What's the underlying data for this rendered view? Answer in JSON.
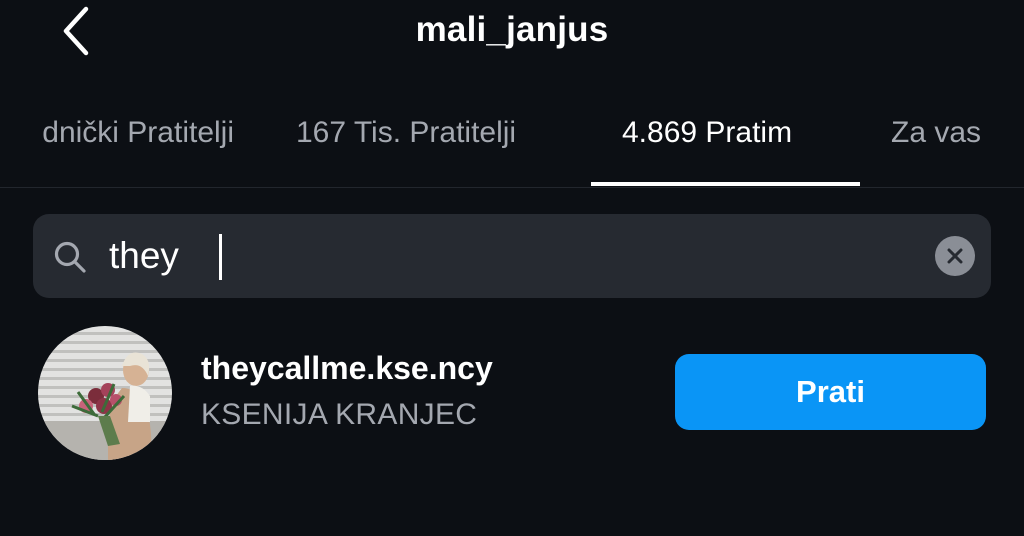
{
  "header": {
    "title": "mali_janjus",
    "back_icon": "chevron-left-icon"
  },
  "tabs": [
    {
      "label": "dnički Pratitelji",
      "active": false
    },
    {
      "label": "167 Tis. Pratitelji",
      "active": false
    },
    {
      "label": "4.869 Pratim",
      "active": true
    },
    {
      "label": "Za vas",
      "active": false
    }
  ],
  "search": {
    "value": "they",
    "icon": "search-icon",
    "clear_icon": "clear-icon"
  },
  "results": [
    {
      "username": "theycallme.kse.ncy",
      "full_name": "KSENIJA KRANJEC",
      "button_label": "Prati"
    }
  ],
  "colors": {
    "background": "#0c0f14",
    "search_bg": "#262a31",
    "accent": "#0a95f6",
    "secondary_text": "#a4a8b0"
  }
}
